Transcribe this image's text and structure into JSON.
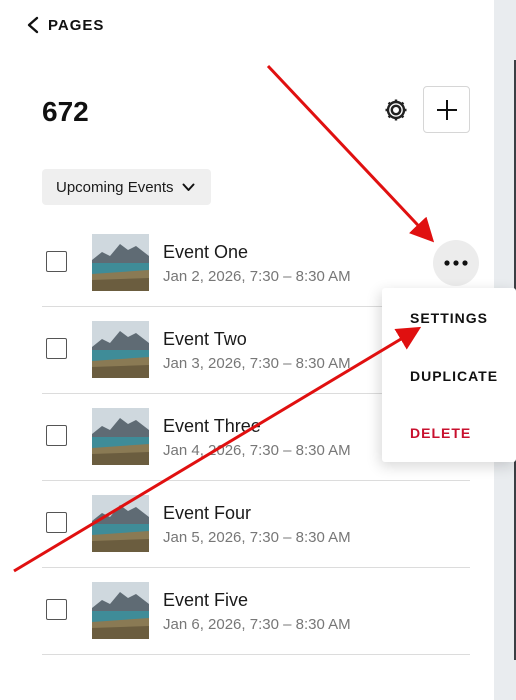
{
  "nav": {
    "back_label": "PAGES"
  },
  "header": {
    "title": "672"
  },
  "filter": {
    "label": "Upcoming Events"
  },
  "events": [
    {
      "name": "Event One",
      "date": "Jan 2, 2026, 7:30 – 8:30 AM"
    },
    {
      "name": "Event Two",
      "date": "Jan 3, 2026, 7:30 – 8:30 AM"
    },
    {
      "name": "Event Three",
      "date": "Jan 4, 2026, 7:30 – 8:30 AM"
    },
    {
      "name": "Event Four",
      "date": "Jan 5, 2026, 7:30 – 8:30 AM"
    },
    {
      "name": "Event Five",
      "date": "Jan 6, 2026, 7:30 – 8:30 AM"
    }
  ],
  "context_menu": {
    "settings_label": "SETTINGS",
    "duplicate_label": "DUPLICATE",
    "delete_label": "DELETE"
  },
  "icons": {
    "back": "chevron-left-icon",
    "settings": "gear-icon",
    "add": "plus-icon",
    "filter": "chevron-down-icon",
    "more": "ellipsis-icon"
  },
  "colors": {
    "delete": "#c8102e",
    "annotation_arrow": "#e01010"
  }
}
